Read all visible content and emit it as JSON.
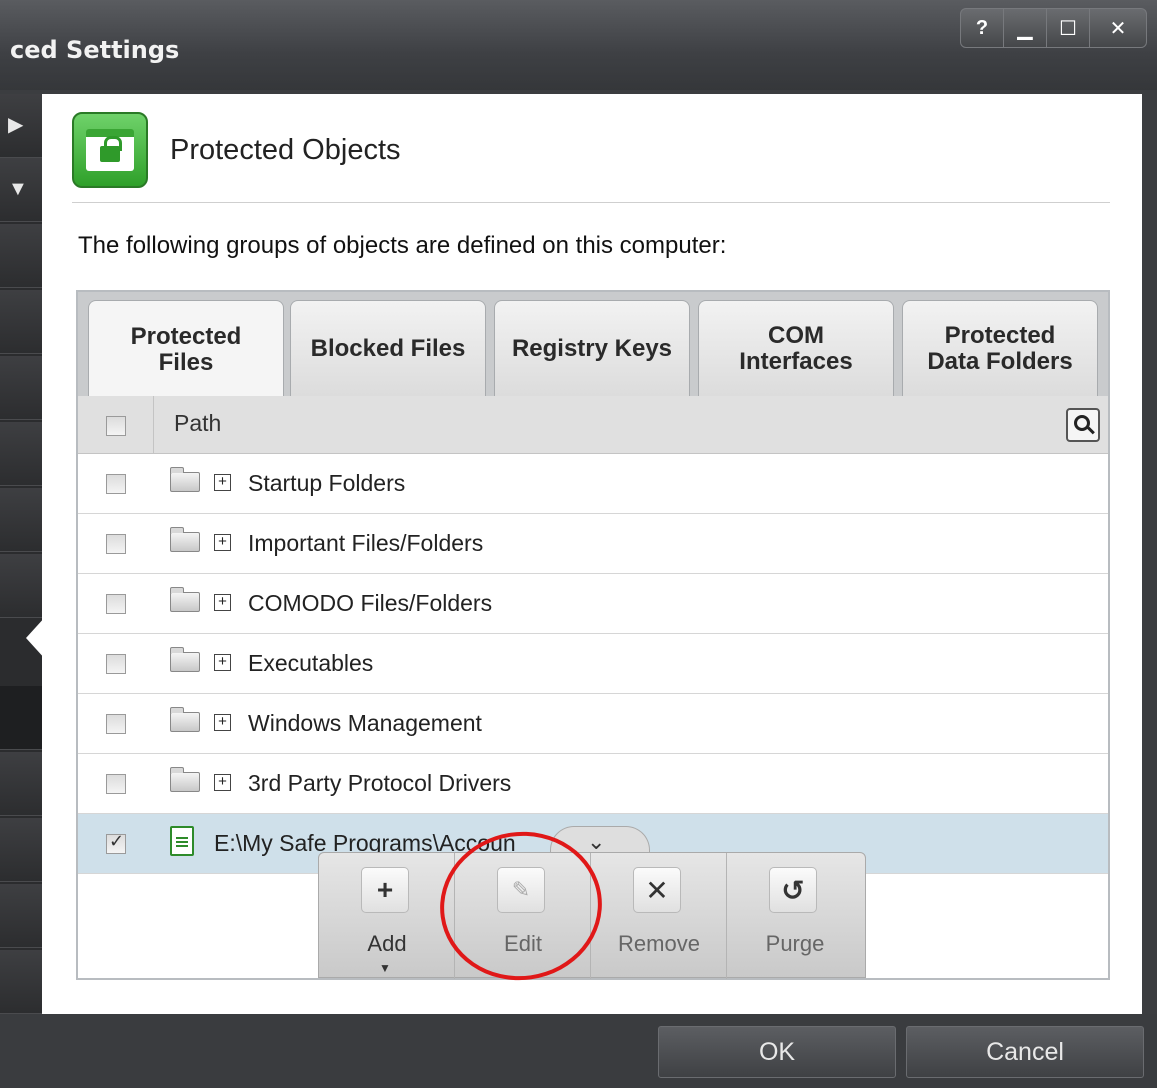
{
  "window": {
    "title": "ced Settings",
    "controls": [
      {
        "name": "help-button",
        "glyph": "?"
      },
      {
        "name": "minimize-button",
        "glyph": "▁"
      },
      {
        "name": "maximize-button",
        "glyph": "☐"
      },
      {
        "name": "close-button",
        "glyph": "✕"
      }
    ]
  },
  "header": {
    "title": "Protected Objects",
    "icon": "protected-objects-lock-icon",
    "accent": "#3aa534"
  },
  "intro": "The following groups of objects are defined on this computer:",
  "tabs": [
    {
      "label": "Protected\nFiles",
      "active": true
    },
    {
      "label": "Blocked Files",
      "active": false
    },
    {
      "label": "Registry Keys",
      "active": false
    },
    {
      "label": "COM\nInterfaces",
      "active": false
    },
    {
      "label": "Protected\nData Folders",
      "active": false
    }
  ],
  "table": {
    "column": "Path",
    "rows": [
      {
        "label": "Startup Folders",
        "checked": false,
        "type": "group"
      },
      {
        "label": "Important Files/Folders",
        "checked": false,
        "type": "group"
      },
      {
        "label": "COMODO Files/Folders",
        "checked": false,
        "type": "group"
      },
      {
        "label": "Executables",
        "checked": false,
        "type": "group"
      },
      {
        "label": "Windows Management",
        "checked": false,
        "type": "group"
      },
      {
        "label": "3rd Party Protocol Drivers",
        "checked": false,
        "type": "group"
      },
      {
        "label": "E:\\My Safe Programs\\Accoun",
        "checked": true,
        "type": "file",
        "selected": true
      }
    ]
  },
  "toolbar": {
    "add": "Add",
    "edit": "Edit",
    "remove": "Remove",
    "purge": "Purge"
  },
  "buttons": {
    "ok": "OK",
    "cancel": "Cancel"
  },
  "colors": {
    "selection": "#cfe0ea",
    "highlight_circle": "#e01818"
  }
}
